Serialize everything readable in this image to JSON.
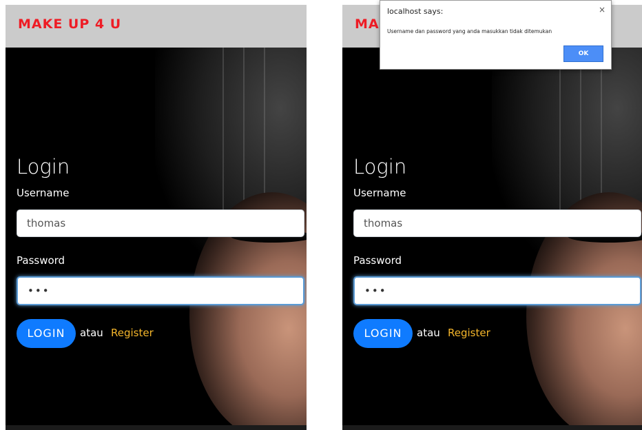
{
  "brand": "MAKE UP 4 U",
  "login": {
    "title": "Login",
    "username_label": "Username",
    "username_value": "thomas",
    "password_label": "Password",
    "password_value": "•••",
    "login_button": "LOGIN",
    "or_text": "atau",
    "register_link": "Register"
  },
  "dialog": {
    "title": "localhost says:",
    "message": "Username dan password yang anda masukkan tidak ditemukan",
    "ok_button": "OK",
    "close": "×"
  },
  "colors": {
    "brand": "#ee1c25",
    "navbar": "#cbcbcb",
    "button": "#0f7bff",
    "register": "#f5b62b"
  }
}
